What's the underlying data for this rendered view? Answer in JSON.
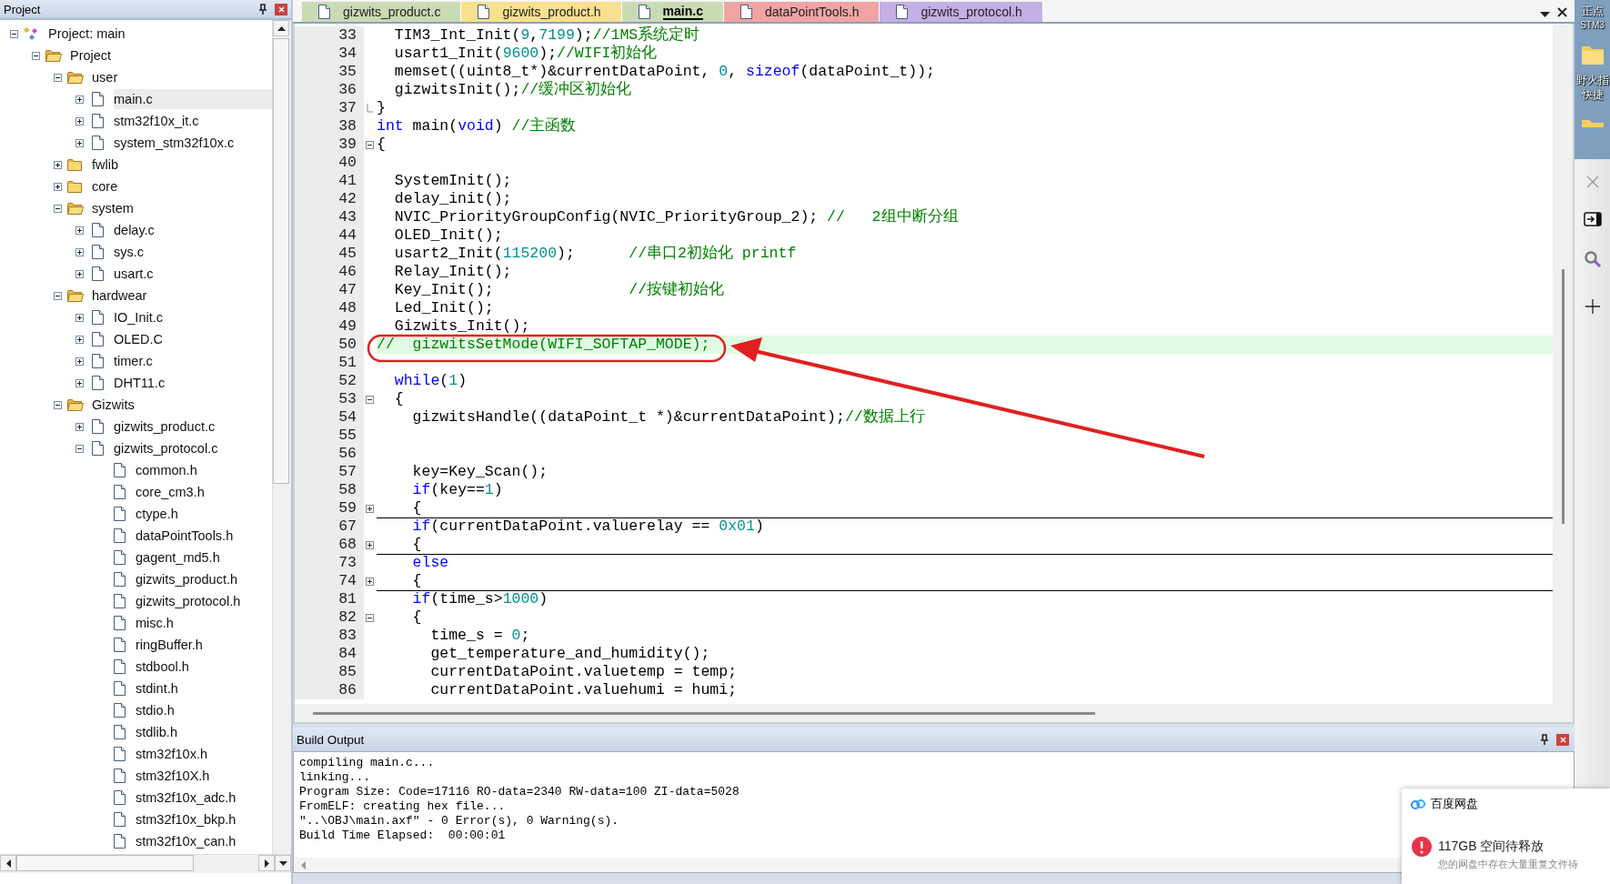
{
  "project_panel": {
    "title": "Project",
    "tree": [
      {
        "label": "Project: main",
        "kind": "target",
        "expanded": true,
        "selected": false,
        "children": [
          {
            "label": "Project",
            "kind": "project",
            "expanded": true,
            "selected": false,
            "children": [
              {
                "label": "user",
                "kind": "folder",
                "expanded": true,
                "selected": false,
                "children": [
                  {
                    "label": "main.c",
                    "kind": "file",
                    "expanded": false,
                    "selected": true
                  },
                  {
                    "label": "stm32f10x_it.c",
                    "kind": "file",
                    "expanded": false,
                    "selected": false
                  },
                  {
                    "label": "system_stm32f10x.c",
                    "kind": "file",
                    "expanded": false,
                    "selected": false
                  }
                ]
              },
              {
                "label": "fwlib",
                "kind": "folder",
                "expanded": false,
                "selected": false
              },
              {
                "label": "core",
                "kind": "folder",
                "expanded": false,
                "selected": false
              },
              {
                "label": "system",
                "kind": "folder",
                "expanded": true,
                "selected": false,
                "children": [
                  {
                    "label": "delay.c",
                    "kind": "file",
                    "expanded": false,
                    "selected": false
                  },
                  {
                    "label": "sys.c",
                    "kind": "file",
                    "expanded": false,
                    "selected": false
                  },
                  {
                    "label": "usart.c",
                    "kind": "file",
                    "expanded": false,
                    "selected": false
                  }
                ]
              },
              {
                "label": "hardwear",
                "kind": "folder",
                "expanded": true,
                "selected": false,
                "children": [
                  {
                    "label": "IO_Init.c",
                    "kind": "file",
                    "expanded": false,
                    "selected": false
                  },
                  {
                    "label": "OLED.C",
                    "kind": "file",
                    "expanded": false,
                    "selected": false
                  },
                  {
                    "label": "timer.c",
                    "kind": "file",
                    "expanded": false,
                    "selected": false
                  },
                  {
                    "label": "DHT11.c",
                    "kind": "file",
                    "expanded": false,
                    "selected": false
                  }
                ]
              },
              {
                "label": "Gizwits",
                "kind": "folder",
                "expanded": true,
                "selected": false,
                "children": [
                  {
                    "label": "gizwits_product.c",
                    "kind": "file",
                    "expanded": false,
                    "selected": false
                  },
                  {
                    "label": "gizwits_protocol.c",
                    "kind": "file",
                    "expanded": true,
                    "selected": false,
                    "children": [
                      {
                        "label": "common.h",
                        "kind": "header",
                        "selected": false
                      },
                      {
                        "label": "core_cm3.h",
                        "kind": "header",
                        "selected": false
                      },
                      {
                        "label": "ctype.h",
                        "kind": "header",
                        "selected": false
                      },
                      {
                        "label": "dataPointTools.h",
                        "kind": "header",
                        "selected": false
                      },
                      {
                        "label": "gagent_md5.h",
                        "kind": "header",
                        "selected": false
                      },
                      {
                        "label": "gizwits_product.h",
                        "kind": "header",
                        "selected": false
                      },
                      {
                        "label": "gizwits_protocol.h",
                        "kind": "header",
                        "selected": false
                      },
                      {
                        "label": "misc.h",
                        "kind": "header",
                        "selected": false
                      },
                      {
                        "label": "ringBuffer.h",
                        "kind": "header",
                        "selected": false
                      },
                      {
                        "label": "stdbool.h",
                        "kind": "header",
                        "selected": false
                      },
                      {
                        "label": "stdint.h",
                        "kind": "header",
                        "selected": false
                      },
                      {
                        "label": "stdio.h",
                        "kind": "header",
                        "selected": false
                      },
                      {
                        "label": "stdlib.h",
                        "kind": "header",
                        "selected": false
                      },
                      {
                        "label": "stm32f10x.h",
                        "kind": "header",
                        "selected": false
                      },
                      {
                        "label": "stm32f10X.h",
                        "kind": "header",
                        "selected": false
                      },
                      {
                        "label": "stm32f10x_adc.h",
                        "kind": "header",
                        "selected": false
                      },
                      {
                        "label": "stm32f10x_bkp.h",
                        "kind": "header",
                        "selected": false
                      },
                      {
                        "label": "stm32f10x_can.h",
                        "kind": "header",
                        "selected": false
                      }
                    ]
                  }
                ]
              }
            ]
          }
        ]
      }
    ]
  },
  "editor": {
    "tabs": [
      {
        "label": "gizwits_product.c",
        "selected": false,
        "color": "#c9dbb4"
      },
      {
        "label": "gizwits_product.h",
        "selected": false,
        "color": "#f9e08e"
      },
      {
        "label": "main.c",
        "selected": true,
        "color": "#c9dbb4"
      },
      {
        "label": "dataPointTools.h",
        "selected": false,
        "color": "#f1a4a4"
      },
      {
        "label": "gizwits_protocol.h",
        "selected": false,
        "color": "#c4b0e4"
      }
    ],
    "lines": [
      {
        "n": "33",
        "kind": "plain",
        "highlighted": false,
        "tokens": [
          {
            "kind": "plain",
            "text": "  TIM3_Int_Init("
          },
          {
            "kind": "number",
            "text": "9"
          },
          {
            "kind": "plain",
            "text": ","
          },
          {
            "kind": "number",
            "text": "7199"
          },
          {
            "kind": "plain",
            "text": ");"
          },
          {
            "kind": "comment",
            "text": "//1MS系统定时"
          }
        ]
      },
      {
        "n": "34",
        "kind": "plain",
        "highlighted": false,
        "tokens": [
          {
            "kind": "plain",
            "text": "  usart1_Init("
          },
          {
            "kind": "number",
            "text": "9600"
          },
          {
            "kind": "plain",
            "text": ");"
          },
          {
            "kind": "comment",
            "text": "//WIFI初始化"
          }
        ]
      },
      {
        "n": "35",
        "kind": "plain",
        "highlighted": false,
        "tokens": [
          {
            "kind": "plain",
            "text": "  memset((uint8_t*)&currentDataPoint, "
          },
          {
            "kind": "number",
            "text": "0"
          },
          {
            "kind": "plain",
            "text": ", "
          },
          {
            "kind": "keyword",
            "text": "sizeof"
          },
          {
            "kind": "plain",
            "text": "(dataPoint_t));"
          }
        ]
      },
      {
        "n": "36",
        "kind": "plain",
        "highlighted": false,
        "tokens": [
          {
            "kind": "plain",
            "text": "  gizwitsInit();"
          },
          {
            "kind": "comment",
            "text": "//缓冲区初始化"
          }
        ]
      },
      {
        "n": "37",
        "kind": "closer",
        "highlighted": false,
        "tokens": [
          {
            "kind": "plain",
            "text": "}"
          }
        ]
      },
      {
        "n": "38",
        "kind": "plain",
        "highlighted": false,
        "tokens": [
          {
            "kind": "keyword",
            "text": "int"
          },
          {
            "kind": "plain",
            "text": " main("
          },
          {
            "kind": "keyword",
            "text": "void"
          },
          {
            "kind": "plain",
            "text": ") "
          },
          {
            "kind": "comment",
            "text": "//主函数"
          }
        ]
      },
      {
        "n": "39",
        "kind": "opener",
        "highlighted": false,
        "tokens": [
          {
            "kind": "plain",
            "text": "{"
          }
        ]
      },
      {
        "n": "40",
        "kind": "plain",
        "highlighted": false
      },
      {
        "n": "41",
        "kind": "plain",
        "highlighted": false,
        "tokens": [
          {
            "kind": "plain",
            "text": "  SystemInit();"
          }
        ]
      },
      {
        "n": "42",
        "kind": "plain",
        "highlighted": false,
        "tokens": [
          {
            "kind": "plain",
            "text": "  delay_init();"
          }
        ]
      },
      {
        "n": "43",
        "kind": "plain",
        "highlighted": false,
        "tokens": [
          {
            "kind": "plain",
            "text": "  NVIC_PriorityGroupConfig(NVIC_PriorityGroup_2); "
          },
          {
            "kind": "comment",
            "text": "//   2组中断分组"
          }
        ]
      },
      {
        "n": "44",
        "kind": "plain",
        "highlighted": false,
        "tokens": [
          {
            "kind": "plain",
            "text": "  OLED_Init();"
          }
        ]
      },
      {
        "n": "45",
        "kind": "plain",
        "highlighted": false,
        "tokens": [
          {
            "kind": "plain",
            "text": "  usart2_Init("
          },
          {
            "kind": "number",
            "text": "115200"
          },
          {
            "kind": "plain",
            "text": ");      "
          },
          {
            "kind": "comment",
            "text": "//串口2初始化 printf"
          }
        ]
      },
      {
        "n": "46",
        "kind": "plain",
        "highlighted": false,
        "tokens": [
          {
            "kind": "plain",
            "text": "  Relay_Init();"
          }
        ]
      },
      {
        "n": "47",
        "kind": "plain",
        "highlighted": false,
        "tokens": [
          {
            "kind": "plain",
            "text": "  Key_Init();               "
          },
          {
            "kind": "comment",
            "text": "//按键初始化"
          }
        ]
      },
      {
        "n": "48",
        "kind": "plain",
        "highlighted": false,
        "tokens": [
          {
            "kind": "plain",
            "text": "  Led_Init();"
          }
        ]
      },
      {
        "n": "49",
        "kind": "plain",
        "highlighted": false,
        "tokens": [
          {
            "kind": "plain",
            "text": "  Gizwits_Init();"
          }
        ]
      },
      {
        "n": "50",
        "kind": "plain",
        "highlighted": true,
        "tokens": [
          {
            "kind": "comment",
            "text": "//  gizwitsSetMode(WIFI_SOFTAP_MODE);"
          }
        ]
      },
      {
        "n": "51",
        "kind": "plain",
        "highlighted": false
      },
      {
        "n": "52",
        "kind": "plain",
        "highlighted": false,
        "tokens": [
          {
            "kind": "keyword",
            "text": "  while"
          },
          {
            "kind": "plain",
            "text": "("
          },
          {
            "kind": "number",
            "text": "1"
          },
          {
            "kind": "plain",
            "text": ")"
          }
        ]
      },
      {
        "n": "53",
        "kind": "opener",
        "highlighted": false,
        "tokens": [
          {
            "kind": "plain",
            "text": "  {"
          }
        ]
      },
      {
        "n": "54",
        "kind": "plain",
        "highlighted": false,
        "tokens": [
          {
            "kind": "plain",
            "text": "    gizwitsHandle((dataPoint_t *)&currentDataPoint);"
          },
          {
            "kind": "comment",
            "text": "//数据上行"
          }
        ]
      },
      {
        "n": "55",
        "kind": "plain",
        "highlighted": false
      },
      {
        "n": "56",
        "kind": "plain",
        "highlighted": false
      },
      {
        "n": "57",
        "kind": "plain",
        "highlighted": false,
        "tokens": [
          {
            "kind": "plain",
            "text": "    key=Key_Scan();"
          }
        ]
      },
      {
        "n": "58",
        "kind": "plain",
        "highlighted": false,
        "tokens": [
          {
            "kind": "keyword",
            "text": "    if"
          },
          {
            "kind": "plain",
            "text": "(key=="
          },
          {
            "kind": "number",
            "text": "1"
          },
          {
            "kind": "plain",
            "text": ")"
          }
        ]
      },
      {
        "n": "59",
        "kind": "collapsed",
        "highlighted": false,
        "tokens": [
          {
            "kind": "plain",
            "text": "    {"
          }
        ]
      },
      {
        "n": "67",
        "kind": "plain",
        "highlighted": false,
        "tokens": [
          {
            "kind": "keyword",
            "text": "    if"
          },
          {
            "kind": "plain",
            "text": "(currentDataPoint.valuerelay == "
          },
          {
            "kind": "number",
            "text": "0x01"
          },
          {
            "kind": "plain",
            "text": ")"
          }
        ]
      },
      {
        "n": "68",
        "kind": "collapsed",
        "highlighted": false,
        "tokens": [
          {
            "kind": "plain",
            "text": "    {"
          }
        ]
      },
      {
        "n": "73",
        "kind": "plain",
        "highlighted": false,
        "tokens": [
          {
            "kind": "keyword",
            "text": "    else"
          }
        ]
      },
      {
        "n": "74",
        "kind": "collapsed",
        "highlighted": false,
        "tokens": [
          {
            "kind": "plain",
            "text": "    {"
          }
        ]
      },
      {
        "n": "81",
        "kind": "plain",
        "highlighted": false,
        "tokens": [
          {
            "kind": "keyword",
            "text": "    if"
          },
          {
            "kind": "plain",
            "text": "(time_s>"
          },
          {
            "kind": "number",
            "text": "1000"
          },
          {
            "kind": "plain",
            "text": ")"
          }
        ]
      },
      {
        "n": "82",
        "kind": "opener",
        "highlighted": false,
        "tokens": [
          {
            "kind": "plain",
            "text": "    {"
          }
        ]
      },
      {
        "n": "83",
        "kind": "plain",
        "highlighted": false,
        "tokens": [
          {
            "kind": "plain",
            "text": "      time_s = "
          },
          {
            "kind": "number",
            "text": "0"
          },
          {
            "kind": "plain",
            "text": ";"
          }
        ]
      },
      {
        "n": "84",
        "kind": "plain",
        "highlighted": false,
        "tokens": [
          {
            "kind": "plain",
            "text": "      get_temperature_and_humidity();"
          }
        ]
      },
      {
        "n": "85",
        "kind": "plain",
        "highlighted": false,
        "tokens": [
          {
            "kind": "plain",
            "text": "      currentDataPoint.valuetemp = temp;"
          }
        ]
      },
      {
        "n": "86",
        "kind": "plain",
        "highlighted": false,
        "tokens": [
          {
            "kind": "plain",
            "text": "      currentDataPoint.valuehumi = humi;"
          }
        ]
      }
    ]
  },
  "build_output": {
    "title": "Build Output",
    "lines": [
      "compiling main.c...",
      "linking...",
      "Program Size: Code=17116 RO-data=2340 RW-data=100 ZI-data=5028",
      "FromELF: creating hex file...",
      "\"..\\OBJ\\main.axf\" - 0 Error(s), 0 Warning(s).",
      "Build Time Elapsed:  00:00:01"
    ]
  },
  "desktop": {
    "labels": [
      "正点",
      "STM3",
      "野火指",
      "快捷"
    ]
  },
  "notification": {
    "title": "百度网盘",
    "message": "117GB 空间待释放",
    "detail": "您的网盘中存在大量重复文件待"
  }
}
